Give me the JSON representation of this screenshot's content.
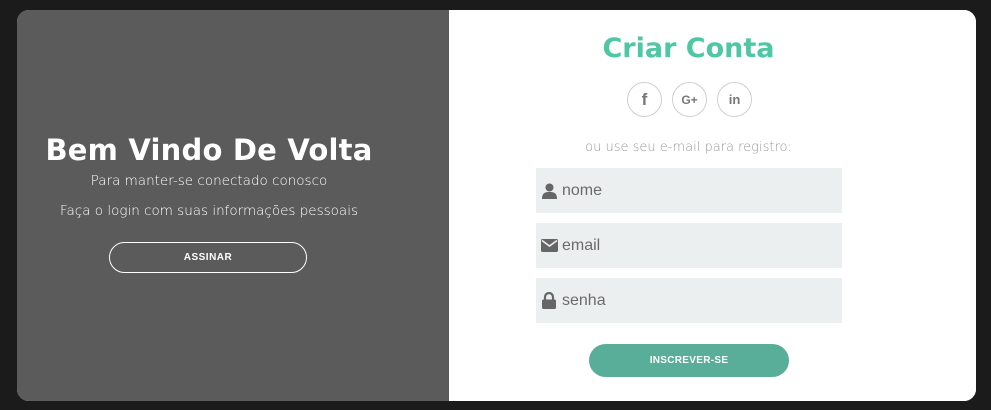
{
  "left_panel": {
    "title": "Bem Vindo De Volta",
    "subtitle_1": "Para manter-se conectado conosco",
    "subtitle_2": "Faça o login com suas informações pessoais",
    "signin_label": "ASSINAR"
  },
  "right_panel": {
    "title": "Criar Conta",
    "social": [
      {
        "icon": "facebook-icon",
        "glyph": "f"
      },
      {
        "icon": "google-plus-icon",
        "glyph": "G+"
      },
      {
        "icon": "linkedin-icon",
        "glyph": "in"
      }
    ],
    "hint": "ou use seu e-mail para registro:",
    "fields": {
      "name_placeholder": "nome",
      "email_placeholder": "email",
      "password_placeholder": "senha"
    },
    "signup_label": "INSCREVER-SE"
  },
  "colors": {
    "accent": "#4dc7a4",
    "button": "#58ae98",
    "left_bg": "#5b5b5b",
    "field_bg": "#eceff0"
  }
}
